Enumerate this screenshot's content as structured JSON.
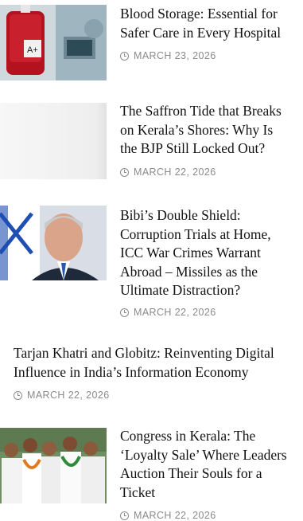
{
  "articles": [
    {
      "title_lines": [
        "Blood Storage: Essential for",
        "Safer Care in Every Hospital"
      ],
      "date": "MARCH 23, 2026",
      "thumb": "blood-storage-image"
    },
    {
      "title_lines": [
        "The Saffron Tide that Breaks",
        "on Kerala’s Shores: Why Is",
        "the BJP Still Locked Out?"
      ],
      "date": "MARCH 22, 2026",
      "thumb": "blank-image-placeholder"
    },
    {
      "title_lines": [
        "Bibi’s Double Shield:",
        "Corruption Trials at Home,",
        "ICC War Crimes Warrant",
        "Abroad – Missiles as the",
        "Ultimate Distraction?"
      ],
      "date": "MARCH 22, 2026",
      "thumb": "netanyahu-portrait-image"
    },
    {
      "title_lines": [
        "Tarjan Khatri and Globitz: Reinventing Digital",
        "Influence in India’s Information Economy"
      ],
      "date": "MARCH 22, 2026",
      "thumb": null
    },
    {
      "title_lines": [
        "Congress in Kerala: The",
        "‘Loyalty Sale’ Where Leaders",
        "Auction Their Souls for a",
        "Ticket"
      ],
      "date": "MARCH 22, 2026",
      "thumb": "congress-leaders-crowd-image"
    }
  ],
  "colors": {
    "meta": "#8a8a8a",
    "title": "#111111"
  },
  "icons": {
    "date": "clock-icon"
  }
}
